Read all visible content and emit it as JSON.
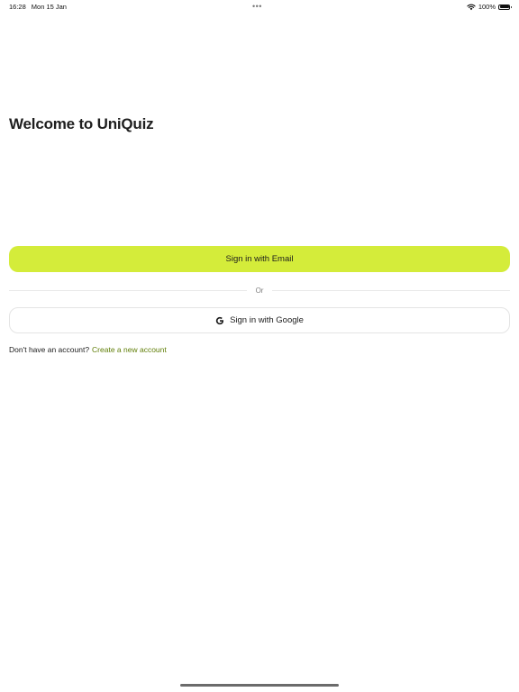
{
  "status_bar": {
    "time": "16:28",
    "date": "Mon 15 Jan",
    "dots": "•••",
    "battery": "100%"
  },
  "welcome": {
    "title": "Welcome to UniQuiz"
  },
  "actions": {
    "email_label": "Sign in with Email",
    "divider_text": "Or",
    "google_label": "Sign in with Google"
  },
  "signup": {
    "prompt": "Don't have an account?",
    "link": "Create a new account"
  },
  "colors": {
    "accent": "#d4ec3a",
    "link": "#5f7d06"
  },
  "icons": {
    "google": "google-g-icon",
    "wifi": "wifi-icon",
    "battery": "battery-icon"
  }
}
